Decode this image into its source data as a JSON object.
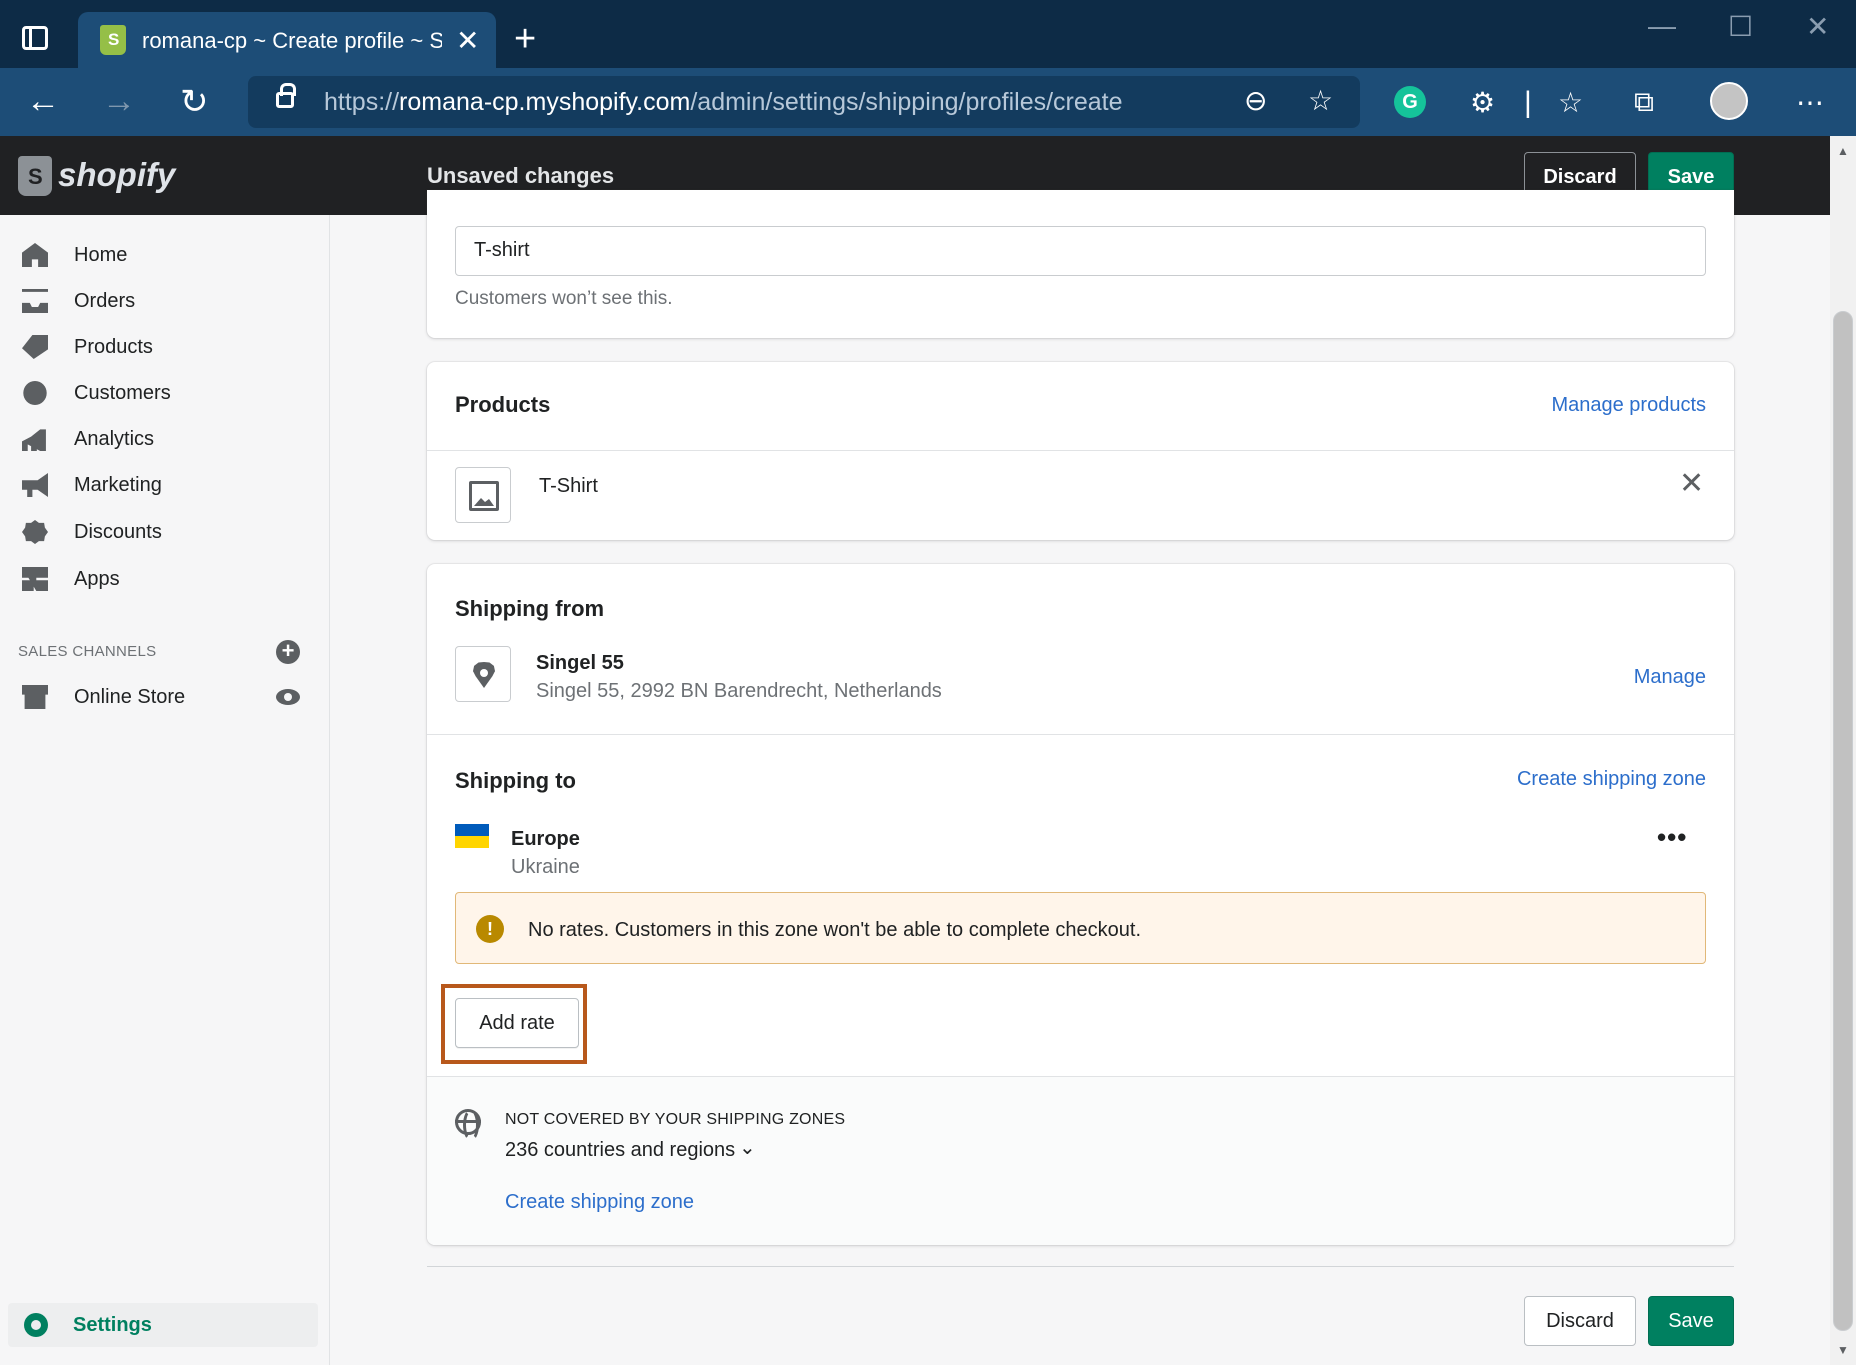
{
  "browser": {
    "tab_title": "romana-cp ~ Create profile ~ Sh",
    "url_prefix": "https://",
    "url_domain": "romana-cp.myshopify.com",
    "url_path": "/admin/settings/shipping/profiles/create"
  },
  "topbar": {
    "logo_text": "shopify",
    "status": "Unsaved changes",
    "discard_label": "Discard",
    "save_label": "Save"
  },
  "sidebar": {
    "items": [
      {
        "label": "Home",
        "icon": "home-icon"
      },
      {
        "label": "Orders",
        "icon": "orders-icon"
      },
      {
        "label": "Products",
        "icon": "tag-icon"
      },
      {
        "label": "Customers",
        "icon": "person-icon"
      },
      {
        "label": "Analytics",
        "icon": "bar-chart-icon"
      },
      {
        "label": "Marketing",
        "icon": "megaphone-icon"
      },
      {
        "label": "Discounts",
        "icon": "discount-icon"
      },
      {
        "label": "Apps",
        "icon": "apps-icon"
      }
    ],
    "sales_channels_title": "SALES CHANNELS",
    "online_store": "Online Store",
    "settings": "Settings"
  },
  "profile_name": {
    "value": "T-shirt",
    "help": "Customers won’t see this."
  },
  "products": {
    "title": "Products",
    "manage_link": "Manage products",
    "items": [
      {
        "name": "T-Shirt"
      }
    ]
  },
  "shipping_from": {
    "title": "Shipping from",
    "location_name": "Singel 55",
    "location_address": "Singel 55, 2992 BN Barendrecht, Netherlands",
    "manage_link": "Manage"
  },
  "shipping_to": {
    "title": "Shipping to",
    "create_zone_link": "Create shipping zone",
    "zone_name": "Europe",
    "zone_country": "Ukraine",
    "warning": "No rates. Customers in this zone won't be able to complete checkout.",
    "add_rate_label": "Add rate"
  },
  "not_covered": {
    "title": "NOT COVERED BY YOUR SHIPPING ZONES",
    "count_text": "236 countries and regions",
    "create_zone_link": "Create shipping zone"
  },
  "footer": {
    "discard_label": "Discard",
    "save_label": "Save"
  },
  "colors": {
    "primary_green": "#008060",
    "link_blue": "#2c6ecb",
    "highlight": "#b8581b",
    "browser_dark": "#0d2b46"
  }
}
